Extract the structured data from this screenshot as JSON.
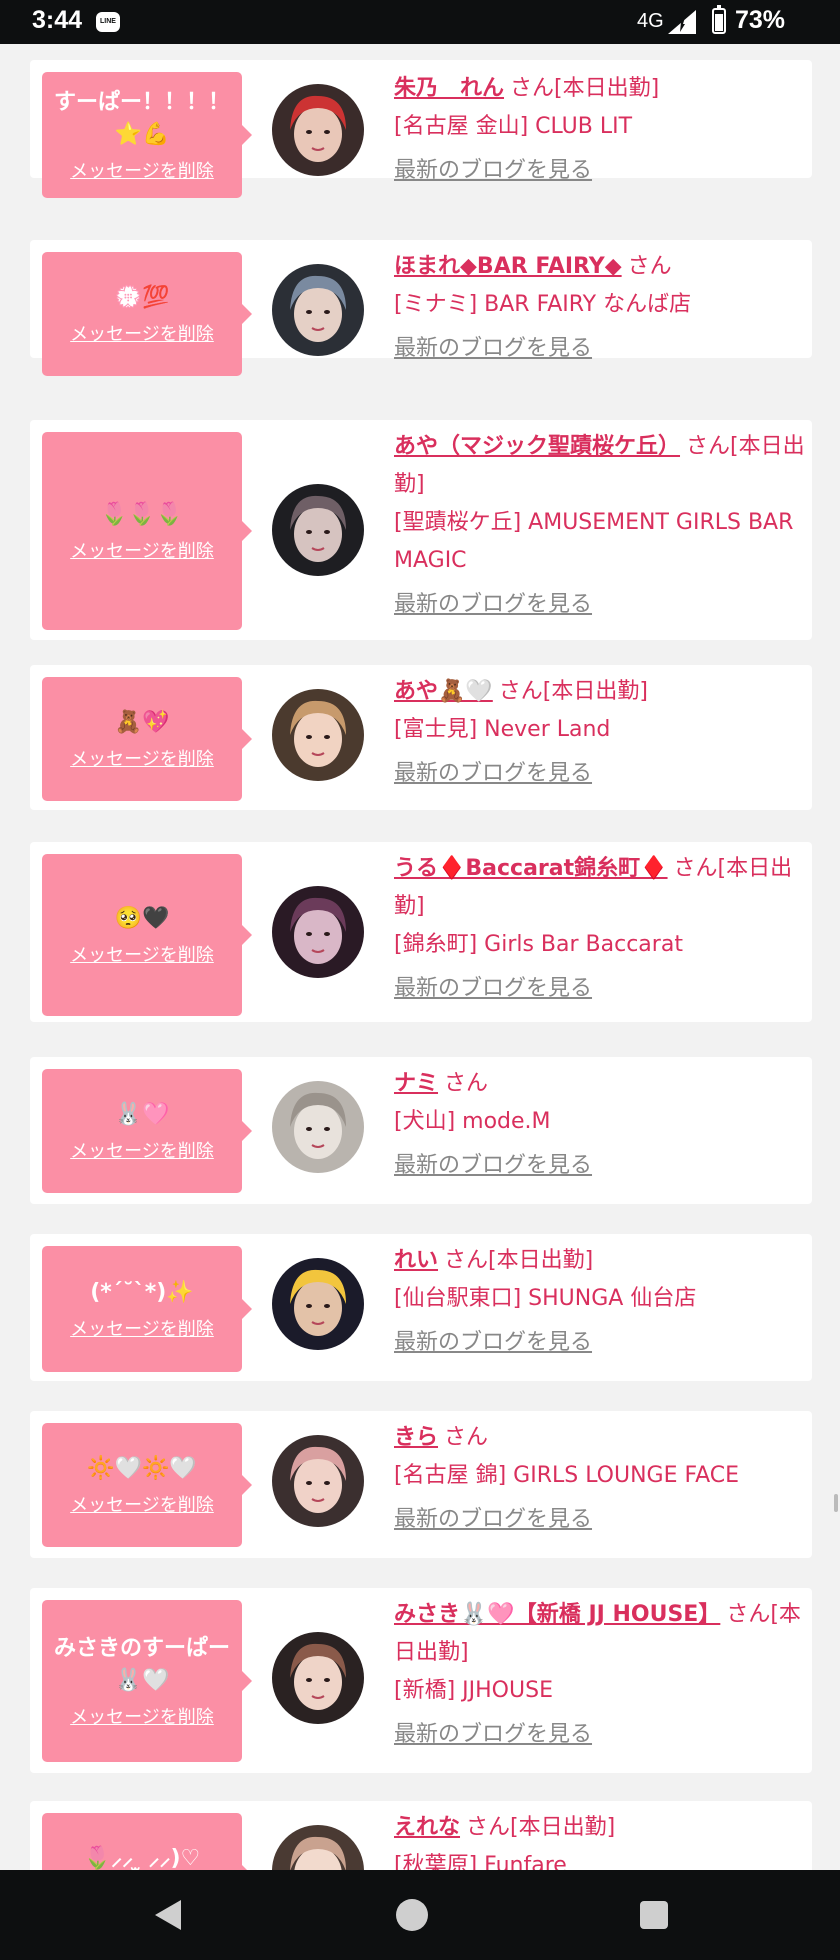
{
  "status_bar": {
    "time": "3:44",
    "app_icon": "LINE",
    "network": "4G",
    "battery": "73%"
  },
  "delete_label": "メッセージを削除",
  "blog_label": "最新のブログを見る",
  "cards": [
    {
      "message": "すーぱー！！！！⭐💪",
      "name": "朱乃　れん",
      "suffix": "さん[本日出勤]",
      "shop": "[名古屋 金山] CLUB LIT"
    },
    {
      "message": "💮💯",
      "name": "ほまれ◆BAR FAIRY◆",
      "suffix": "さん",
      "shop": "[ミナミ] BAR FAIRY なんば店"
    },
    {
      "message": "🌷🌷🌷",
      "name": "あや（マジック聖蹟桜ケ丘）",
      "suffix": "さん[本日出勤]",
      "shop": "[聖蹟桜ケ丘] AMUSEMENT GIRLS BAR MAGIC"
    },
    {
      "message": "🧸💖",
      "name": "あや🧸🤍",
      "suffix": "さん[本日出勤]",
      "shop": "[富士見] Never Land"
    },
    {
      "message": "🥺🖤",
      "name": "うる♦️Baccarat錦糸町♦️",
      "suffix": "さん[本日出勤]",
      "shop": "[錦糸町] Girls Bar Baccarat"
    },
    {
      "message": "🐰🩷",
      "name": "ナミ",
      "suffix": "さん",
      "shop": "[犬山] mode.M"
    },
    {
      "message": "(*´˘`*)✨",
      "name": "れい",
      "suffix": "さん[本日出勤]",
      "shop": "[仙台駅東口] SHUNGA 仙台店"
    },
    {
      "message": "🔆🤍🔆🤍",
      "name": "きら",
      "suffix": "さん",
      "shop": "[名古屋 錦] GIRLS LOUNGE FACE"
    },
    {
      "message": "みさきのすーぱー🐰🤍",
      "name": "みさき🐰🩷【新橋 JJ HOUSE】",
      "suffix": "さん[本日出勤]",
      "shop": "[新橋] JJHOUSE"
    },
    {
      "message": "🌷⸝⸝ ̫ ⸝⸝)♡",
      "name": "えれな",
      "suffix": "さん[本日出勤]",
      "shop": "[秋葉原] Funfare"
    }
  ],
  "colors": {
    "bubble": "#fb8fa5",
    "name_text": "#d92f5d",
    "blog_text": "#888888",
    "background": "#f2f2f2"
  }
}
